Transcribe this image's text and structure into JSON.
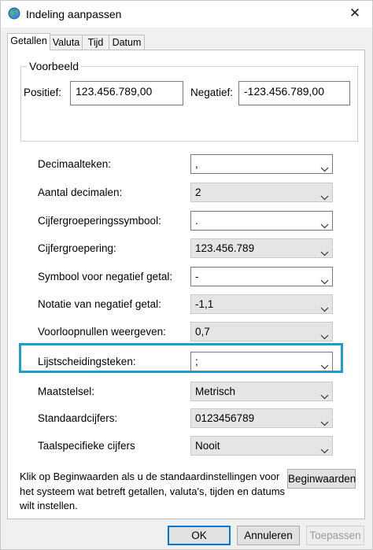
{
  "window": {
    "title": "Indeling aanpassen",
    "icon": "globe-clock-icon",
    "close_glyph": "✕"
  },
  "tabs": [
    {
      "label": "Getallen",
      "active": true
    },
    {
      "label": "Valuta",
      "active": false
    },
    {
      "label": "Tijd",
      "active": false
    },
    {
      "label": "Datum",
      "active": false
    }
  ],
  "example": {
    "group_title": "Voorbeeld",
    "positive_label": "Positief:",
    "positive_value": "123.456.789,00",
    "negative_label": "Negatief:",
    "negative_value": "-123.456.789,00"
  },
  "settings": [
    {
      "label": "Decimaalteken:",
      "value": ",",
      "kind": "editable"
    },
    {
      "label": "Aantal decimalen:",
      "value": "2",
      "kind": "dropdown"
    },
    {
      "label": "Cijfergroeperingssymbool:",
      "value": ".",
      "kind": "editable"
    },
    {
      "label": "Cijfergroepering:",
      "value": "123.456.789",
      "kind": "dropdown"
    },
    {
      "label": "Symbool voor negatief getal:",
      "value": "-",
      "kind": "editable"
    },
    {
      "label": "Notatie van negatief getal:",
      "value": "-1,1",
      "kind": "dropdown"
    },
    {
      "label": "Voorloopnullen weergeven:",
      "value": "0,7",
      "kind": "dropdown"
    },
    {
      "label": "Lijstscheidingsteken:",
      "value": ";",
      "kind": "editable",
      "highlighted": true
    },
    {
      "label": "Maatstelsel:",
      "value": "Metrisch",
      "kind": "dropdown"
    },
    {
      "label": "Standaardcijfers:",
      "value": "0123456789",
      "kind": "dropdown"
    },
    {
      "label": "Taalspecifieke cijfers",
      "value": "Nooit",
      "kind": "dropdown"
    }
  ],
  "highlight_color": "#1a9fd3",
  "info": {
    "text": "Klik op Beginwaarden als u de standaardinstellingen voor het systeem wat betreft getallen, valuta's, tijden en datums wilt instellen."
  },
  "buttons": {
    "reset": "Beginwaarden",
    "ok": "OK",
    "cancel": "Annuleren",
    "apply": "Toepassen"
  }
}
